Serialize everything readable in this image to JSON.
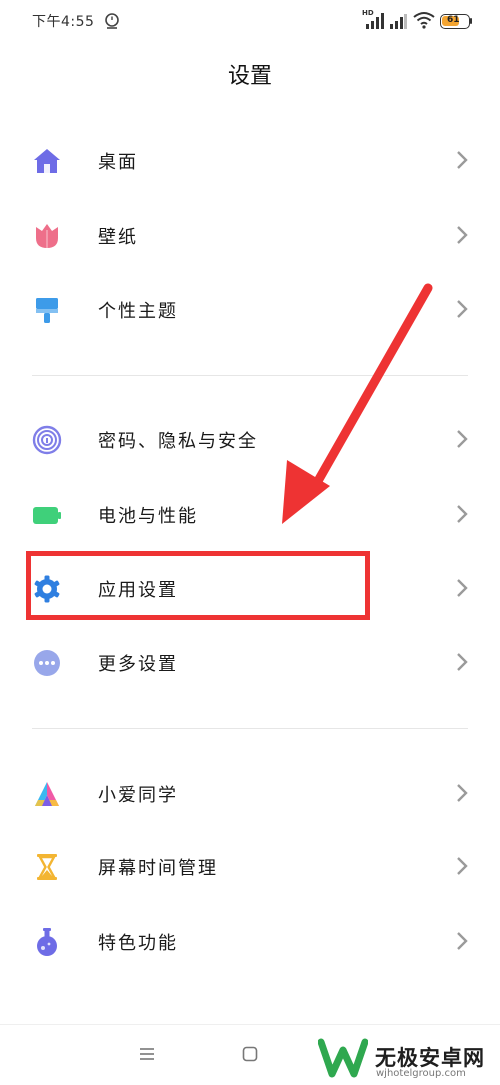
{
  "status_bar": {
    "time": "下午4:55",
    "network_label": "HD",
    "battery_level": "61"
  },
  "header": {
    "title": "设置"
  },
  "groups": [
    {
      "items": [
        {
          "label": "桌面",
          "icon": "home-icon"
        },
        {
          "label": "壁纸",
          "icon": "tulip-icon"
        },
        {
          "label": "个性主题",
          "icon": "brush-icon"
        }
      ]
    },
    {
      "items": [
        {
          "label": "密码、隐私与安全",
          "icon": "fingerprint-icon"
        },
        {
          "label": "电池与性能",
          "icon": "battery-icon"
        },
        {
          "label": "应用设置",
          "icon": "gear-icon"
        },
        {
          "label": "更多设置",
          "icon": "more-icon"
        }
      ]
    },
    {
      "items": [
        {
          "label": "小爱同学",
          "icon": "xiaoai-icon"
        },
        {
          "label": "屏幕时间管理",
          "icon": "hourglass-icon"
        },
        {
          "label": "特色功能",
          "icon": "flask-icon"
        }
      ]
    }
  ],
  "colors": {
    "highlight": "#ee3333",
    "arrow": "#ee3333",
    "icon_purple": "#6e6ce6",
    "icon_pink": "#ee6f8a",
    "icon_blue": "#3d9be9",
    "icon_green": "#3fd07a",
    "icon_yellow": "#f3b532"
  },
  "watermark": {
    "text": "无极安卓网",
    "url": "wjhotelgroup.com"
  }
}
